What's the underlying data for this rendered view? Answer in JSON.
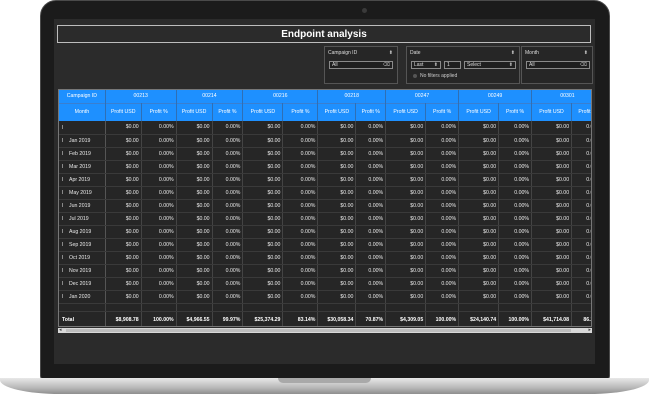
{
  "report": {
    "title": "Endpoint analysis"
  },
  "slicers": {
    "campaign": {
      "label": "Campaign ID",
      "value": "All"
    },
    "date": {
      "label": "Date",
      "mode": "Last",
      "count": "1",
      "unit": "Select",
      "note": "No filters applied"
    },
    "month": {
      "label": "Month",
      "value": "All"
    }
  },
  "table": {
    "row_header_label": "Campaign ID",
    "month_header_label": "Month",
    "campaigns": [
      "00213",
      "00214",
      "00216",
      "00218",
      "00247",
      "00249",
      "00301",
      "0"
    ],
    "measure_labels": [
      "Profit USD",
      "Profit %"
    ],
    "rows": [
      {
        "month": "",
        "cells": [
          "$0.00",
          "0.00%",
          "$0.00",
          "0.00%",
          "$0.00",
          "0.00%",
          "$0.00",
          "0.00%",
          "$0.00",
          "0.00%",
          "$0.00",
          "0.00%",
          "$0.00",
          "0.00%",
          "$0.00"
        ]
      },
      {
        "month": "Jan 2019",
        "cells": [
          "$0.00",
          "0.00%",
          "$0.00",
          "0.00%",
          "$0.00",
          "0.00%",
          "$0.00",
          "0.00%",
          "$0.00",
          "0.00%",
          "$0.00",
          "0.00%",
          "$0.00",
          "0.00%",
          "$0.00"
        ]
      },
      {
        "month": "Feb 2019",
        "cells": [
          "$0.00",
          "0.00%",
          "$0.00",
          "0.00%",
          "$0.00",
          "0.00%",
          "$0.00",
          "0.00%",
          "$0.00",
          "0.00%",
          "$0.00",
          "0.00%",
          "$0.00",
          "0.00%",
          "$0.00"
        ]
      },
      {
        "month": "Mar 2019",
        "cells": [
          "$0.00",
          "0.00%",
          "$0.00",
          "0.00%",
          "$0.00",
          "0.00%",
          "$0.00",
          "0.00%",
          "$0.00",
          "0.00%",
          "$0.00",
          "0.00%",
          "$0.00",
          "0.00%",
          "$0.00"
        ]
      },
      {
        "month": "Apr 2019",
        "cells": [
          "$0.00",
          "0.00%",
          "$0.00",
          "0.00%",
          "$0.00",
          "0.00%",
          "$0.00",
          "0.00%",
          "$0.00",
          "0.00%",
          "$0.00",
          "0.00%",
          "$0.00",
          "0.00%",
          "$0.00"
        ]
      },
      {
        "month": "May 2019",
        "cells": [
          "$0.00",
          "0.00%",
          "$0.00",
          "0.00%",
          "$0.00",
          "0.00%",
          "$0.00",
          "0.00%",
          "$0.00",
          "0.00%",
          "$0.00",
          "0.00%",
          "$0.00",
          "0.00%",
          "$0.00"
        ]
      },
      {
        "month": "Jun 2019",
        "cells": [
          "$0.00",
          "0.00%",
          "$0.00",
          "0.00%",
          "$0.00",
          "0.00%",
          "$0.00",
          "0.00%",
          "$0.00",
          "0.00%",
          "$0.00",
          "0.00%",
          "$0.00",
          "0.00%",
          "$0.00"
        ]
      },
      {
        "month": "Jul 2019",
        "cells": [
          "$0.00",
          "0.00%",
          "$0.00",
          "0.00%",
          "$0.00",
          "0.00%",
          "$0.00",
          "0.00%",
          "$0.00",
          "0.00%",
          "$0.00",
          "0.00%",
          "$0.00",
          "0.00%",
          "$0.00"
        ]
      },
      {
        "month": "Aug 2019",
        "cells": [
          "$0.00",
          "0.00%",
          "$0.00",
          "0.00%",
          "$0.00",
          "0.00%",
          "$0.00",
          "0.00%",
          "$0.00",
          "0.00%",
          "$0.00",
          "0.00%",
          "$0.00",
          "0.00%",
          "$0.00"
        ]
      },
      {
        "month": "Sep 2019",
        "cells": [
          "$0.00",
          "0.00%",
          "$0.00",
          "0.00%",
          "$0.00",
          "0.00%",
          "$0.00",
          "0.00%",
          "$0.00",
          "0.00%",
          "$0.00",
          "0.00%",
          "$0.00",
          "0.00%",
          "$0.00"
        ]
      },
      {
        "month": "Oct 2019",
        "cells": [
          "$0.00",
          "0.00%",
          "$0.00",
          "0.00%",
          "$0.00",
          "0.00%",
          "$0.00",
          "0.00%",
          "$0.00",
          "0.00%",
          "$0.00",
          "0.00%",
          "$0.00",
          "0.00%",
          "$0.00"
        ]
      },
      {
        "month": "Nov 2019",
        "cells": [
          "$0.00",
          "0.00%",
          "$0.00",
          "0.00%",
          "$0.00",
          "0.00%",
          "$0.00",
          "0.00%",
          "$0.00",
          "0.00%",
          "$0.00",
          "0.00%",
          "$0.00",
          "0.00%",
          "$0.00"
        ]
      },
      {
        "month": "Dec 2019",
        "cells": [
          "$0.00",
          "0.00%",
          "$0.00",
          "0.00%",
          "$0.00",
          "0.00%",
          "$0.00",
          "0.00%",
          "$0.00",
          "0.00%",
          "$0.00",
          "0.00%",
          "$0.00",
          "0.00%",
          "$0.00"
        ]
      },
      {
        "month": "Jan 2020",
        "cells": [
          "$0.00",
          "0.00%",
          "$0.00",
          "0.00%",
          "$0.00",
          "0.00%",
          "$0.00",
          "0.00%",
          "$0.00",
          "0.00%",
          "$0.00",
          "0.00%",
          "$0.00",
          "0.00%",
          "$0.00"
        ]
      }
    ],
    "total": {
      "label": "Total",
      "cells": [
        "$8,908.78",
        "100.00%",
        "$4,966.55",
        "99.97%",
        "$25,374.29",
        "83.14%",
        "$30,058.34",
        "70.87%",
        "$4,309.05",
        "100.00%",
        "$24,140.74",
        "100.00%",
        "$41,714.08",
        "86.22%",
        "$7,710"
      ]
    }
  },
  "colors": {
    "header_blue": "#1e90ff",
    "background": "#2b2b2b"
  },
  "icons": {
    "scroll_left": "◂",
    "scroll_right": "▸",
    "clear": "⌫",
    "caret": "⬍"
  }
}
